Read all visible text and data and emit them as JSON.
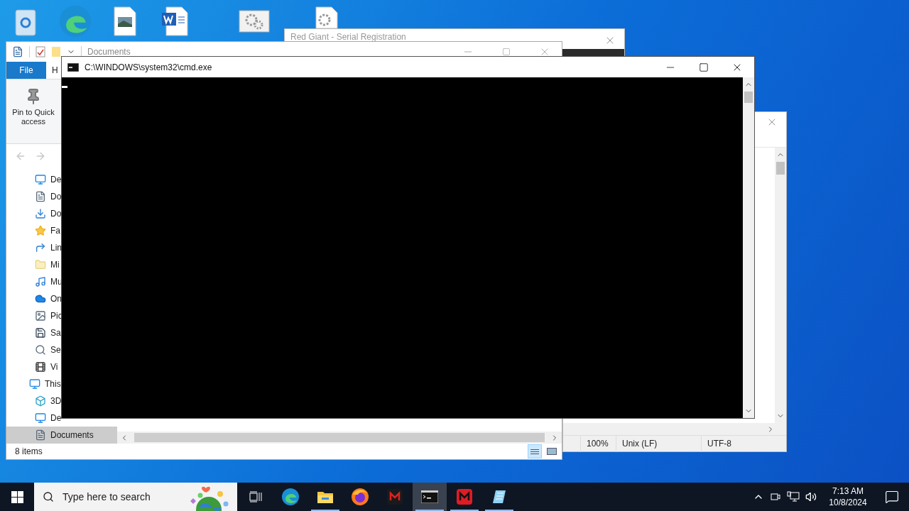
{
  "red_giant_window": {
    "title": "Red Giant - Serial Registration"
  },
  "explorer_window": {
    "address": "Documents",
    "file_tab": "File",
    "home_tab": "H",
    "pin_button": "Pin to Quick access",
    "quick_items": [
      {
        "kind": "desktop",
        "label": "De",
        "selected": false
      },
      {
        "kind": "document",
        "label": "Do",
        "selected": false
      },
      {
        "kind": "download",
        "label": "Do",
        "selected": false
      },
      {
        "kind": "star",
        "label": "Fa",
        "selected": false
      },
      {
        "kind": "link",
        "label": "Lin",
        "selected": false
      },
      {
        "kind": "folder",
        "label": "Mi",
        "selected": false
      },
      {
        "kind": "music",
        "label": "Mu",
        "selected": false
      },
      {
        "kind": "cloud",
        "label": "On",
        "selected": false
      },
      {
        "kind": "picture",
        "label": "Pic",
        "selected": false
      },
      {
        "kind": "saved",
        "label": "Sa",
        "selected": false
      },
      {
        "kind": "search",
        "label": "Se",
        "selected": false
      },
      {
        "kind": "video",
        "label": "Vi",
        "selected": false
      }
    ],
    "this_pc": {
      "label": "This",
      "children": [
        {
          "kind": "cube",
          "label": "3D",
          "selected": false
        },
        {
          "kind": "desktop",
          "label": "De",
          "selected": false
        },
        {
          "kind": "document",
          "label": "Documents",
          "selected": true
        }
      ]
    },
    "status": "8 items"
  },
  "editor_window": {
    "status_bar": [
      "100%",
      "Unix (LF)",
      "UTF-8"
    ]
  },
  "cmd_window": {
    "title": "C:\\WINDOWS\\system32\\cmd.exe"
  },
  "taskbar": {
    "search_placeholder": "Type here to search",
    "apps": [
      {
        "kind": "edge",
        "running": false,
        "selected": false
      },
      {
        "kind": "folder",
        "running": true,
        "selected": false
      },
      {
        "kind": "firefox",
        "running": false,
        "selected": false
      },
      {
        "kind": "m-dark",
        "running": false,
        "selected": false
      },
      {
        "kind": "terminal",
        "running": true,
        "selected": true
      },
      {
        "kind": "m-red",
        "running": true,
        "selected": false
      },
      {
        "kind": "notepad",
        "running": true,
        "selected": false
      }
    ],
    "time": "7:13 AM",
    "date": "10/8/2024"
  }
}
